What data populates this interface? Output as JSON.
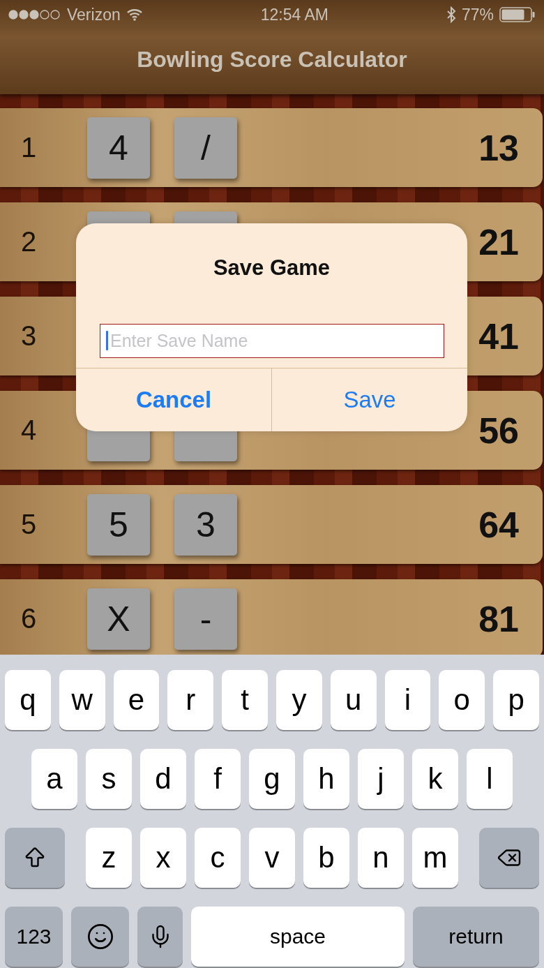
{
  "status_bar": {
    "carrier": "Verizon",
    "time": "12:54 AM",
    "battery": "77%"
  },
  "title": "Bowling Score Calculator",
  "frames": [
    {
      "number": "1",
      "balls": [
        {
          "kind": "shown",
          "label": "4"
        },
        {
          "kind": "shown",
          "label": "/"
        }
      ],
      "score": "13"
    },
    {
      "number": "2",
      "balls": [
        {
          "kind": "covered"
        },
        {
          "kind": "covered"
        }
      ],
      "score": "21"
    },
    {
      "number": "3",
      "score": "41"
    },
    {
      "number": "4",
      "balls": [
        {
          "kind": "covered"
        },
        {
          "kind": "covered"
        }
      ],
      "score": "56"
    },
    {
      "number": "5",
      "balls": [
        {
          "kind": "shown",
          "label": "5"
        },
        {
          "kind": "shown",
          "label": "3"
        }
      ],
      "score": "64"
    },
    {
      "number": "6",
      "balls": [
        {
          "kind": "shown",
          "label": "X"
        },
        {
          "kind": "shown",
          "label": "-"
        }
      ],
      "score": "81"
    }
  ],
  "dialog": {
    "title": "Save Game",
    "input": {
      "placeholder": "Enter Save Name"
    },
    "buttons": [
      {
        "kind": "cancel",
        "label": "Cancel"
      },
      {
        "kind": "default",
        "label": "Save"
      }
    ]
  },
  "keyboard": {
    "rows": [
      {
        "kind": "top",
        "keys": [
          {
            "kind": "char",
            "label": "q"
          },
          {
            "kind": "char",
            "label": "w"
          },
          {
            "kind": "char",
            "label": "e"
          },
          {
            "kind": "char",
            "label": "r"
          },
          {
            "kind": "char",
            "label": "t"
          },
          {
            "kind": "char",
            "label": "y"
          },
          {
            "kind": "char",
            "label": "u"
          },
          {
            "kind": "char",
            "label": "i"
          },
          {
            "kind": "char",
            "label": "o"
          },
          {
            "kind": "char",
            "label": "p"
          }
        ]
      },
      {
        "kind": "middle",
        "keys": [
          {
            "kind": "char",
            "label": "a"
          },
          {
            "kind": "char",
            "label": "s"
          },
          {
            "kind": "char",
            "label": "d"
          },
          {
            "kind": "char",
            "label": "f"
          },
          {
            "kind": "char",
            "label": "g"
          },
          {
            "kind": "char",
            "label": "h"
          },
          {
            "kind": "char",
            "label": "j"
          },
          {
            "kind": "char",
            "label": "k"
          },
          {
            "kind": "char",
            "label": "l"
          }
        ]
      },
      {
        "kind": "shift",
        "keys": [
          {
            "kind": "shift"
          },
          {
            "kind": "char",
            "label": "z"
          },
          {
            "kind": "char",
            "label": "x"
          },
          {
            "kind": "char",
            "label": "c"
          },
          {
            "kind": "char",
            "label": "v"
          },
          {
            "kind": "char",
            "label": "b"
          },
          {
            "kind": "char",
            "label": "n"
          },
          {
            "kind": "char",
            "label": "m"
          },
          {
            "kind": "delete"
          }
        ]
      },
      {
        "kind": "bottom",
        "keys": [
          {
            "kind": "numbers",
            "label": "123"
          },
          {
            "kind": "emoji"
          },
          {
            "kind": "mic"
          },
          {
            "kind": "space",
            "label": "space"
          },
          {
            "kind": "return",
            "label": "return"
          }
        ]
      }
    ]
  }
}
